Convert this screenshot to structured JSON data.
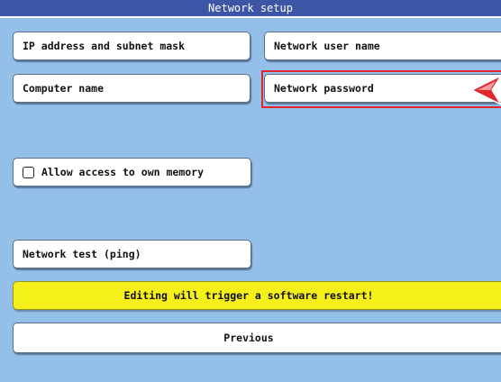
{
  "window": {
    "title": "Network setup"
  },
  "buttons": {
    "ip_address": "IP address and subnet mask",
    "network_user_name": "Network user name",
    "computer_name": "Computer name",
    "network_password": "Network password",
    "allow_access": "Allow access to own memory",
    "network_test": "Network test (ping)",
    "previous": "Previous"
  },
  "checkbox": {
    "allow_access_checked": false
  },
  "warning": {
    "text": "Editing will trigger a software restart!"
  },
  "colors": {
    "background": "#93bfe8",
    "titlebar": "#3c55a5",
    "warning": "#f5ef1a",
    "highlight": "#e0262a"
  },
  "icons": {
    "pointer": "red-arrow-pointer-icon"
  }
}
